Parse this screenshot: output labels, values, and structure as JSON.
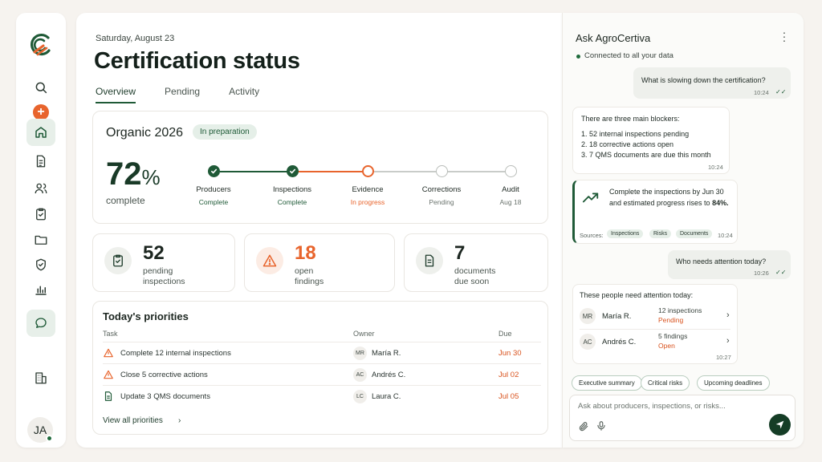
{
  "sidebar": {
    "items": [
      "search-icon",
      "add-icon",
      "home-icon",
      "documents-icon",
      "users-icon",
      "checklist-icon",
      "folder-icon",
      "shield-icon",
      "chart-icon",
      "chat-icon",
      "building-icon"
    ],
    "active": "home",
    "user_initials": "JA"
  },
  "header": {
    "date": "Saturday, August 23",
    "title": "Certification status",
    "tabs": [
      {
        "label": "Overview",
        "active": true
      },
      {
        "label": "Pending",
        "active": false
      },
      {
        "label": "Activity",
        "active": false
      }
    ]
  },
  "progress": {
    "program": "Organic 2026",
    "badge": "In preparation",
    "percent_value": "72",
    "percent_sign": "%",
    "percent_label": "complete",
    "steps": [
      {
        "name": "Producers",
        "status": "Complete",
        "state": "done"
      },
      {
        "name": "Inspections",
        "status": "Complete",
        "state": "done"
      },
      {
        "name": "Evidence",
        "status": "In progress",
        "state": "progress"
      },
      {
        "name": "Corrections",
        "status": "Pending",
        "state": "pending"
      },
      {
        "name": "Audit",
        "status": "Aug 18",
        "state": "pending"
      }
    ]
  },
  "stats": [
    {
      "value": "52",
      "label_1": "pending",
      "label_2": "inspections",
      "icon": "clipboard-check-icon",
      "color": "#1c2620"
    },
    {
      "value": "18",
      "label_1": "open",
      "label_2": "findings",
      "icon": "warning-icon",
      "color": "#e8642c"
    },
    {
      "value": "7",
      "label_1": "documents",
      "label_2": "due soon",
      "icon": "document-icon",
      "color": "#1c2620"
    }
  ],
  "priorities": {
    "title": "Today's priorities",
    "columns": [
      "Task",
      "Owner",
      "Due"
    ],
    "rows": [
      {
        "task": "Complete 12 internal inspections",
        "initials": "MR",
        "owner": "María R.",
        "due": "Jun 30",
        "icon": "warning-icon"
      },
      {
        "task": "Close 5 corrective actions",
        "initials": "AC",
        "owner": "Andrés C.",
        "due": "Jul 02",
        "icon": "warning-icon"
      },
      {
        "task": "Update 3 QMS documents",
        "initials": "LC",
        "owner": "Laura C.",
        "due": "Jul 05",
        "icon": "document-icon"
      }
    ],
    "view_all": "View all priorities"
  },
  "chat": {
    "title": "Ask AgroCertiva",
    "status": "Connected to all your data",
    "msg1": {
      "text": "What is slowing down the certification?",
      "time": "10:24"
    },
    "msg2": {
      "intro": "There are three main blockers:",
      "items": [
        "1.  52 internal inspections pending",
        "2.  18 corrective actions open",
        "3.  7 QMS documents are due this month"
      ],
      "time": "10:24"
    },
    "msg3": {
      "line1": "Complete the inspections by Jun 30",
      "line2_prefix": "and estimated progress rises to ",
      "line2_bold": "84%.",
      "sources_label": "Sources:",
      "sources": [
        "Inspections",
        "Risks",
        "Documents"
      ],
      "time": "10:24"
    },
    "msg4": {
      "text": "Who needs attention today?",
      "time": "10:26"
    },
    "msg5": {
      "intro": "These people need attention today:",
      "people": [
        {
          "initials": "MR",
          "name": "María R.",
          "line1": "12 inspections",
          "line2": "Pending"
        },
        {
          "initials": "AC",
          "name": "Andrés C.",
          "line1": "5 findings",
          "line2": "Open"
        }
      ],
      "time": "10:27"
    },
    "suggestions": [
      "Executive summary",
      "Critical risks",
      "Upcoming deadlines"
    ],
    "input_placeholder": "Ask about producers, inspections, or risks..."
  },
  "colors": {
    "accent": "#1f5a37",
    "warning": "#e8642c"
  }
}
